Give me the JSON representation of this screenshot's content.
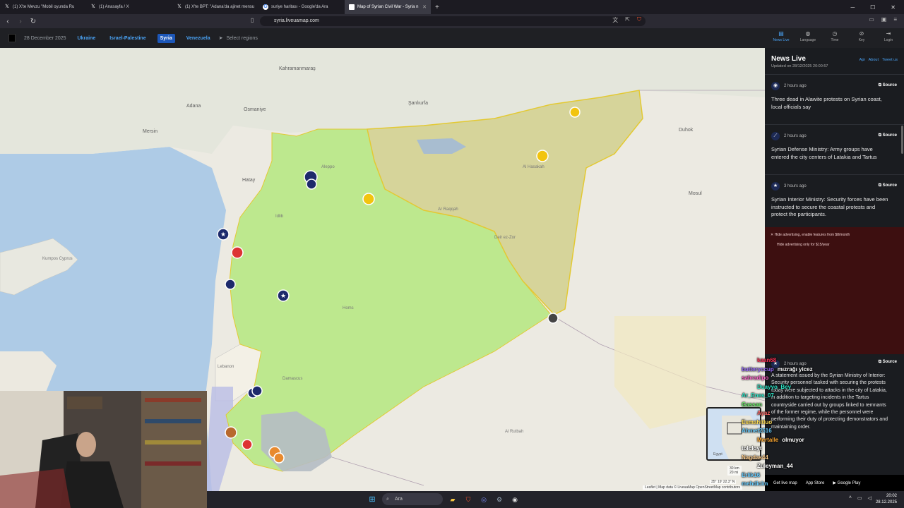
{
  "tabs": [
    {
      "title": "(1) X'te Mevzu \"Mobil oyunda Ru",
      "icon": "x-logo-icon"
    },
    {
      "title": "(1) Anasayfa / X",
      "icon": "x-logo-icon"
    },
    {
      "title": "(1) X'te BPT: \"Adana'da ajinet mensu",
      "icon": "x-logo-icon"
    },
    {
      "title": "suriye haritası - Google'da Ara",
      "icon": "google-icon"
    },
    {
      "title": "Map of Syrian Civil War - Syria n",
      "icon": "liveuamap-icon",
      "active": true
    }
  ],
  "address": {
    "url": "syria.liveuamap.com"
  },
  "site": {
    "date": "28 December 2025",
    "regions": [
      "Ukraine",
      "Israel-Palestine",
      "Syria",
      "Venezuela"
    ],
    "selected_region": "Syria",
    "select_regions": "Select regions",
    "menu": [
      "News Live",
      "Language",
      "Time",
      "Key",
      "Login"
    ]
  },
  "panel": {
    "title": "News Live",
    "links": [
      "Api",
      "About",
      "Tweet us"
    ],
    "updated": "Updated on 28/12/2025 20:00:57",
    "source_label": "Source",
    "items": [
      {
        "time": "2 hours ago",
        "icon": "eye-icon",
        "text": "Three dead in Alawite protests on Syrian coast, local officials say"
      },
      {
        "time": "2 hours ago",
        "icon": "rifle-icon",
        "text": "Syrian Defense Ministry: Army groups have entered the city centers of Latakia and Tartus"
      },
      {
        "time": "3 hours ago",
        "icon": "star-icon",
        "text": "Syrian Interior Ministry: Security forces have been instructed to secure the coastal protests and protect the participants."
      },
      {
        "time": "2 hours ago",
        "icon": "star-icon",
        "text": "A statement issued by the Syrian Ministry of Interior: Security personnel tasked with securing the protests today were subjected to attacks in the city of Latakia, in addition to targeting incidents in the Tartus countryside carried out by groups linked to remnants of the former regime, while the personnel were performing their duty of protecting demonstrators and maintaining order."
      }
    ],
    "ad_line1": "Hide advertising, enable features from $8/month",
    "ad_line2": "Hide advertising only for $15/year"
  },
  "stores": [
    "Get live map",
    "App Store",
    "Google Play"
  ],
  "map": {
    "cities": [
      "Kahramanmaraş",
      "Şanlıurfa",
      "Adana",
      "Mersin",
      "Osmaniye",
      "Hatay",
      "Kumpos Cyprus",
      "Duhok",
      "Mosul",
      "Lebanon",
      "Al Hasakah",
      "Ar Raqqah",
      "Deir ez-Zor",
      "Homs",
      "Damascus",
      "Idlib",
      "Aleppo",
      "Al Rutbah",
      "Egypt"
    ],
    "scale_km": "30 km",
    "scale_mi": "20 mi",
    "coords": "35° 19' 22.3\" N",
    "attribution": "Leaflet | Map data © LiveuaMap OpenStreetMap contributors"
  },
  "chat": [
    {
      "user": "kaan68",
      "msg": "",
      "color": "#ff3355"
    },
    {
      "user": "butteryccup",
      "msg": "mızrağı yicez",
      "color": "#9a6cff"
    },
    {
      "user": "sahradipo",
      "msg": "",
      "color": "#ff66cc"
    },
    {
      "user": "Duayyo_Bey",
      "msg": "",
      "color": "#2ee6c8"
    },
    {
      "user": "Ar_Enes_07",
      "msg": "",
      "color": "#2ee6c8"
    },
    {
      "user": "Gassan",
      "msg": "",
      "color": "#66ee66"
    },
    {
      "user": "Ayaz",
      "msg": "",
      "color": "#ff6666"
    },
    {
      "user": "Esmahitluo",
      "msg": "",
      "color": "#ffdd55"
    },
    {
      "user": "Ahmet2516",
      "msg": "",
      "color": "#66ccff"
    },
    {
      "user": "Mertalle",
      "msg": "olmuyor",
      "color": "#ffaa33"
    },
    {
      "user": "tolcloyt",
      "msg": "",
      "color": "#ffffff"
    },
    {
      "user": "Nagdas44",
      "msg": "",
      "color": "#ffcc88"
    },
    {
      "user": "Zuleyman_44",
      "msg": "",
      "color": "#ffffff"
    },
    {
      "user": "Erlik16",
      "msg": "",
      "color": "#66ccff"
    },
    {
      "user": "mehdicim",
      "msg": "",
      "color": "#66ccff"
    }
  ],
  "taskbar": {
    "search": "Ara",
    "time": "20:02",
    "date": "28.12.2025"
  }
}
